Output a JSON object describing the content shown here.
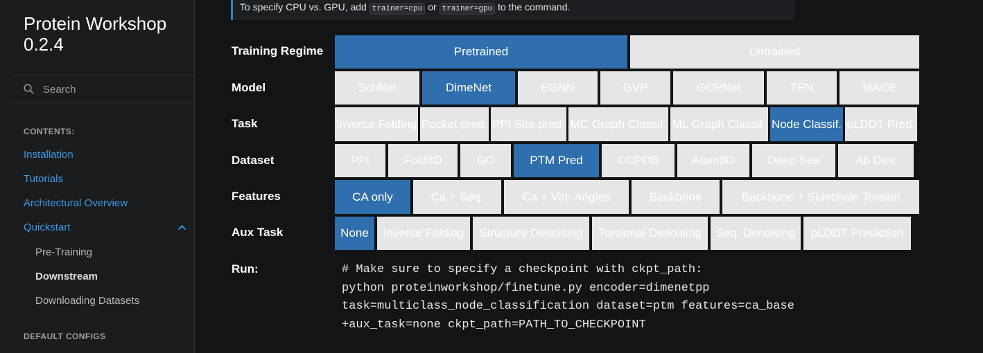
{
  "sidebar": {
    "brand": "Protein Workshop 0.2.4",
    "search_placeholder": "Search",
    "contents_caption": "CONTENTS:",
    "items": [
      {
        "label": "Installation"
      },
      {
        "label": "Tutorials"
      },
      {
        "label": "Architectural Overview"
      },
      {
        "label": "Quickstart"
      },
      {
        "label": "Pre-Training"
      },
      {
        "label": "Downstream"
      },
      {
        "label": "Downloading Datasets"
      }
    ],
    "configs_caption": "DEFAULT CONFIGS"
  },
  "admonition": {
    "prefix": "To specify CPU vs. GPU, add",
    "code1": "trainer=cpu",
    "middle": "or",
    "code2": "trainer=gpu",
    "suffix": "to the command."
  },
  "selector": {
    "rows": [
      {
        "label": "Training Regime",
        "options": [
          {
            "label": "Pretrained",
            "selected": true
          },
          {
            "label": "Untrained",
            "selected": false
          }
        ]
      },
      {
        "label": "Model",
        "options": [
          {
            "label": "SchNet",
            "selected": false
          },
          {
            "label": "DimeNet",
            "selected": true
          },
          {
            "label": "EGNN",
            "selected": false
          },
          {
            "label": "GVP",
            "selected": false
          },
          {
            "label": "GCPNet",
            "selected": false
          },
          {
            "label": "TFN",
            "selected": false
          },
          {
            "label": "MACE",
            "selected": false
          }
        ]
      },
      {
        "label": "Task",
        "options": [
          {
            "label": "Inverse Folding",
            "selected": false
          },
          {
            "label": "Pocket pred.",
            "selected": false
          },
          {
            "label": "PPI Site pred.",
            "selected": false
          },
          {
            "label": "MC Graph Classif.",
            "selected": false
          },
          {
            "label": "ML Graph Classif.",
            "selected": false
          },
          {
            "label": "Node Classif.",
            "selected": true
          },
          {
            "label": "pLDDT Pred.",
            "selected": false
          }
        ]
      },
      {
        "label": "Dataset",
        "options": [
          {
            "label": "PPI",
            "selected": false
          },
          {
            "label": "Fold3D",
            "selected": false
          },
          {
            "label": "GO",
            "selected": false
          },
          {
            "label": "PTM Pred",
            "selected": true
          },
          {
            "label": "CCPDB",
            "selected": false
          },
          {
            "label": "Atom3D",
            "selected": false
          },
          {
            "label": "Deep Sea",
            "selected": false
          },
          {
            "label": "Ab Dev.",
            "selected": false
          }
        ]
      },
      {
        "label": "Features",
        "options": [
          {
            "label": "CA only",
            "selected": true
          },
          {
            "label": "Ca + Seq.",
            "selected": false
          },
          {
            "label": "Ca + Virt. Angles",
            "selected": false
          },
          {
            "label": "Backbone",
            "selected": false
          },
          {
            "label": "Backbone + Sidechain Torsion",
            "selected": false
          }
        ]
      },
      {
        "label": "Aux Task",
        "options": [
          {
            "label": "None",
            "selected": true
          },
          {
            "label": "Inverse Folding",
            "selected": false
          },
          {
            "label": "Structure Denoising",
            "selected": false
          },
          {
            "label": "Torsional Denoising",
            "selected": false
          },
          {
            "label": "Seq. Denoising",
            "selected": false
          },
          {
            "label": "pLDDT Prediction",
            "selected": false
          }
        ]
      }
    ],
    "run_label": "Run:",
    "run_command": "# Make sure to specify a checkpoint with ckpt_path:\npython proteinworkshop/finetune.py encoder=dimenetpp\ntask=multiclass_node_classification dataset=ptm features=ca_base\n+aux_task=none ckpt_path=PATH_TO_CHECKPOINT"
  },
  "colors": {
    "selected": "#2f6fad",
    "unselected": "#e6e6e6",
    "link": "#3f9be5",
    "background": "#131416",
    "sidebar_background": "#1a1c1e"
  }
}
